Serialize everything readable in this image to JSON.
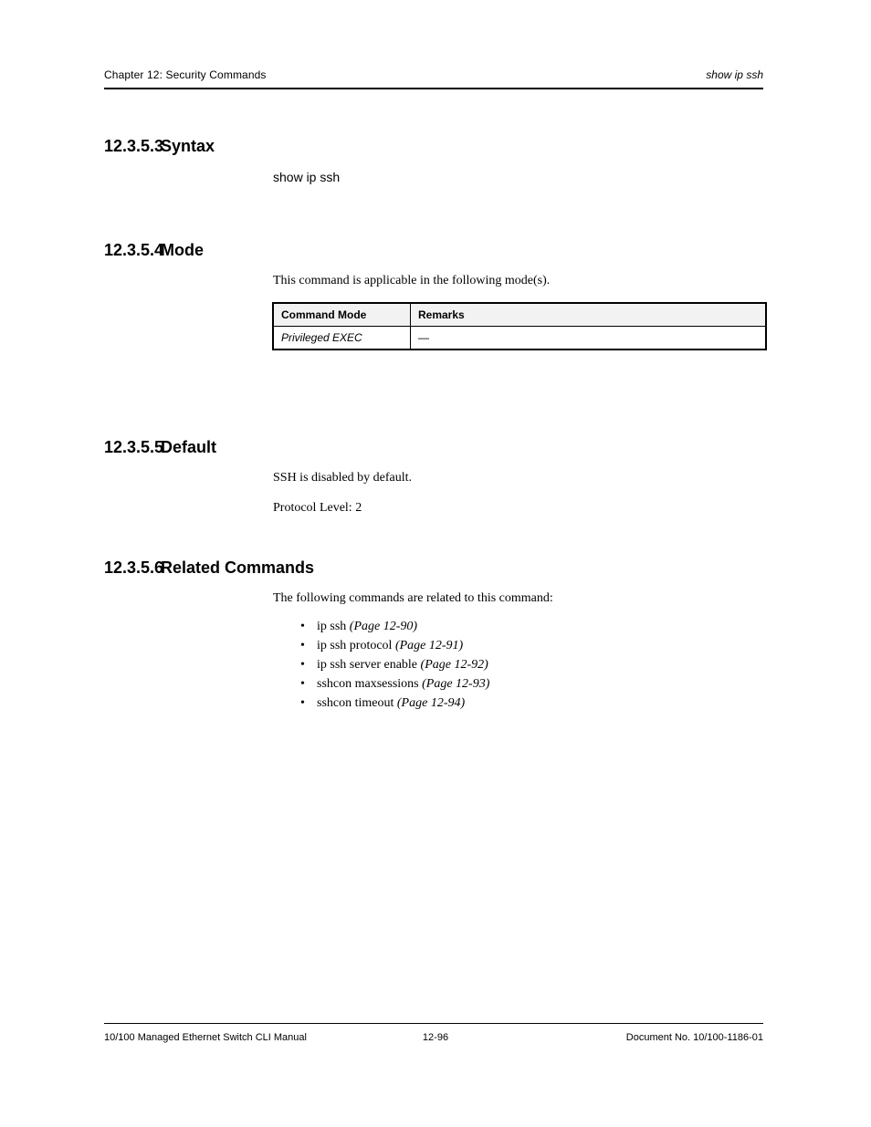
{
  "header": {
    "left": "Chapter 12: Security Commands",
    "right": "show ip ssh"
  },
  "sections": {
    "syntax": {
      "num": "12.3.5.3",
      "title": "Syntax",
      "cmd": "show ip ssh"
    },
    "mode": {
      "num": "12.3.5.4",
      "title": "Mode",
      "intro": "This command is applicable in the following mode(s).",
      "table": {
        "headers": [
          "Command Mode",
          "Remarks"
        ],
        "row": [
          "Privileged EXEC",
          "—"
        ]
      }
    },
    "default": {
      "num": "12.3.5.5",
      "title": "Default",
      "lines": [
        "SSH is disabled by default.",
        "Protocol Level: 2"
      ]
    },
    "related": {
      "num": "12.3.5.6",
      "title": "Related Commands",
      "intro": "The following commands are related to this command:",
      "items": [
        {
          "label": "ip ssh",
          "xref": "(Page 12-90)"
        },
        {
          "label": "ip ssh protocol",
          "xref": "(Page 12-91)"
        },
        {
          "label": "ip ssh server enable",
          "xref": "(Page 12-92)"
        },
        {
          "label": "sshcon maxsessions",
          "xref": "(Page 12-93)"
        },
        {
          "label": "sshcon timeout",
          "xref": "(Page 12-94)"
        }
      ]
    }
  },
  "footer": {
    "left": "10/100 Managed Ethernet Switch CLI Manual",
    "center": "12-96",
    "right": "Document No. 10/100-1186-01"
  }
}
